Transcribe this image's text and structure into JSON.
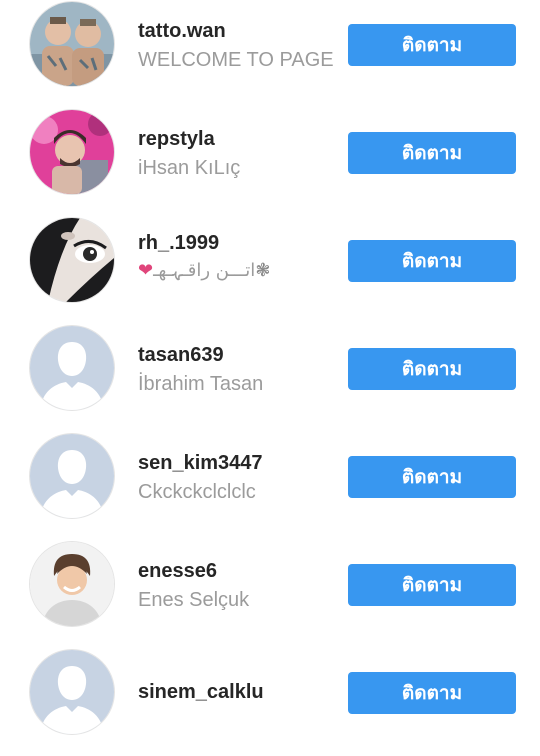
{
  "colors": {
    "button": "#3897f0",
    "username": "#262626",
    "fullname": "#9b9b9b",
    "placeholder_avatar_bg": "#c7d3e3"
  },
  "follow_label": "ติดตาม",
  "users": [
    {
      "username": "tatto.wan",
      "fullname": "WELCOME TO PAGE",
      "avatar": "photo-two-children"
    },
    {
      "username": "repstyla",
      "fullname": "iHsan KıLıç",
      "avatar": "photo-man-pink"
    },
    {
      "username": "rh_.1999",
      "fullname": "اتـــن راقـہـهـ",
      "fullname_prefix_icon": "heart-icon",
      "fullname_suffix_icon": "snowflake-icon",
      "avatar": "photo-eye-dark"
    },
    {
      "username": "tasan639",
      "fullname": "İbrahim Tasan",
      "avatar": "default-placeholder"
    },
    {
      "username": "sen_kim3447",
      "fullname": "Ckckckclclclc",
      "avatar": "default-placeholder"
    },
    {
      "username": "enesse6",
      "fullname": "Enes Selçuk",
      "avatar": "photo-smiling-boy"
    },
    {
      "username": "sinem_calklu",
      "fullname": "",
      "avatar": "default-placeholder"
    }
  ]
}
